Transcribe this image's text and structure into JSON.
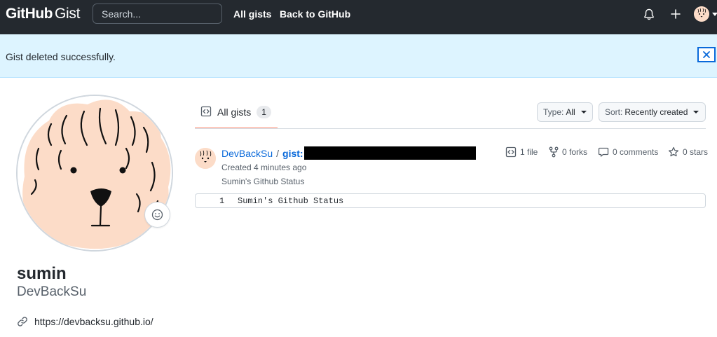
{
  "header": {
    "logo_primary": "GitHub",
    "logo_secondary": "Gist",
    "search_placeholder": "Search...",
    "nav": [
      "All gists",
      "Back to GitHub"
    ]
  },
  "flash": {
    "message": "Gist deleted successfully.",
    "close_label": "×"
  },
  "profile": {
    "name": "sumin",
    "login": "DevBackSu",
    "website": "https://devbacksu.github.io/"
  },
  "tabs": [
    {
      "label": "All gists",
      "count": "1",
      "selected": true
    }
  ],
  "filters": {
    "type_prefix": "Type:",
    "type_value": "All",
    "sort_prefix": "Sort:",
    "sort_value": "Recently created"
  },
  "gist": {
    "owner": "DevBackSu",
    "separator": "/",
    "name_prefix": "gist:",
    "created": "Created 4 minutes ago",
    "description": "Sumin's Github Status",
    "files": "1 file",
    "forks": "0 forks",
    "comments": "0 comments",
    "stars": "0 stars",
    "preview_line_number": "1",
    "preview_line_text": "Sumin's Github Status"
  },
  "icons": {
    "notifications": "bell-icon",
    "create": "plus-icon",
    "file": "code-square-icon",
    "forks": "repo-forked-icon",
    "comments": "comment-icon",
    "stars": "star-icon",
    "link": "link-icon",
    "status": "smiley-icon"
  },
  "colors": {
    "header_bg": "#24292f",
    "flash_bg": "#ddf4ff",
    "link": "#0969da",
    "tab_underline": "#fd8c73",
    "avatar_skin": "#fcdcc8"
  }
}
